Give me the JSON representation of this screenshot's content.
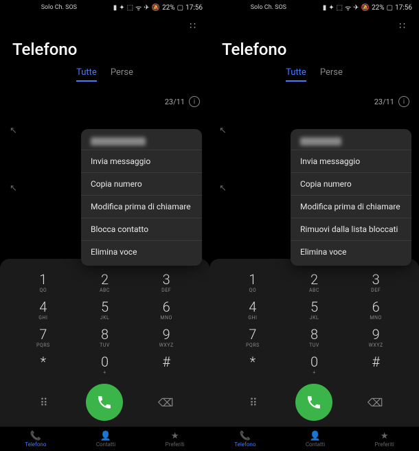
{
  "status": {
    "carrier": "Solo Ch. SOS",
    "battery": "22%",
    "time": "17:56"
  },
  "title": "Telefono",
  "tabs": {
    "all": "Tutte",
    "missed": "Perse"
  },
  "date": "23/11",
  "keys": [
    [
      "1",
      "QO",
      "2",
      "ABC",
      "3",
      "DEF"
    ],
    [
      "4",
      "GHI",
      "5",
      "JKL",
      "6",
      "MNO"
    ],
    [
      "7",
      "PQRS",
      "8",
      "TUV",
      "9",
      "WXYZ"
    ],
    [
      "*",
      "",
      "0",
      "+",
      "#",
      ""
    ]
  ],
  "nav": {
    "phone": "Telefono",
    "contacts": "Contatti",
    "favorites": "Preferiti"
  },
  "popup_common": {
    "send_message": "Invia messaggio",
    "copy_number": "Copia numero",
    "edit_before": "Modifica prima di chiamare",
    "delete": "Elimina voce"
  },
  "popup_left": {
    "block": "Blocca contatto"
  },
  "popup_right": {
    "unblock": "Rimuovi dalla lista bloccati"
  }
}
